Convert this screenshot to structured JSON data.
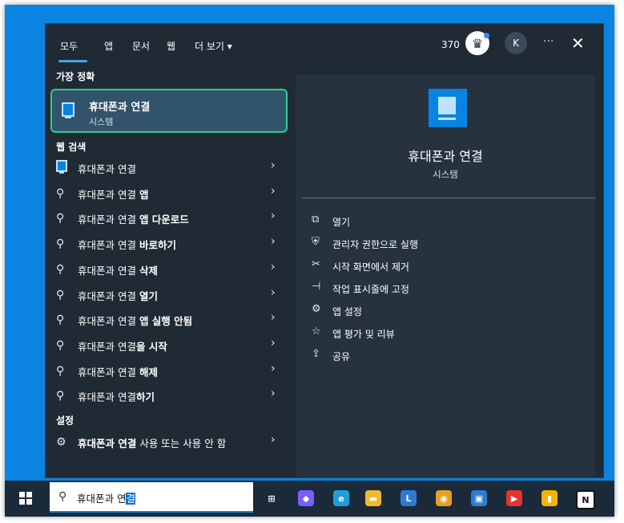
{
  "tabs": [
    "모두",
    "앱",
    "문서",
    "웹",
    "더 보기 ▾"
  ],
  "header": {
    "count": "370",
    "avatar": "K",
    "more": "···",
    "close": "✕"
  },
  "best_match": {
    "section": "가장 정확",
    "title": "휴대폰과 연결",
    "subtitle": "시스템"
  },
  "web_section": "웹 검색",
  "results": [
    {
      "icon": "app",
      "pre": "휴대폰과 연결",
      "bold": ""
    },
    {
      "icon": "search",
      "pre": "휴대폰과 연결 ",
      "bold": "앱"
    },
    {
      "icon": "search",
      "pre": "휴대폰과 연결 ",
      "bold": "앱 다운로드"
    },
    {
      "icon": "search",
      "pre": "휴대폰과 연결 ",
      "bold": "바로하기"
    },
    {
      "icon": "search",
      "pre": "휴대폰과 연결 ",
      "bold": "삭제"
    },
    {
      "icon": "search",
      "pre": "휴대폰과 연결 ",
      "bold": "열기"
    },
    {
      "icon": "search",
      "pre": "휴대폰과 연결 ",
      "bold": "앱 실행 안됨"
    },
    {
      "icon": "search",
      "pre": "휴대폰과 연결",
      "bold": "을 시작"
    },
    {
      "icon": "search",
      "pre": "휴대폰과 연결 ",
      "bold": "해제"
    },
    {
      "icon": "search",
      "pre": "휴대폰과 연결",
      "bold": "하기"
    }
  ],
  "settings_section": "설정",
  "settings_item": {
    "bold": "휴대폰과 연결",
    "rest": " 사용 또는 사용 안 함"
  },
  "detail": {
    "title": "휴대폰과 연결",
    "subtitle": "시스템",
    "actions": [
      {
        "icon": "open-icon",
        "glyph": "⧉",
        "label": "열기"
      },
      {
        "icon": "admin-icon",
        "glyph": "⛨",
        "label": "관리자 권한으로 실행"
      },
      {
        "icon": "unpin-icon",
        "glyph": "✂",
        "label": "시작 화면에서 제거"
      },
      {
        "icon": "pin-taskbar-icon",
        "glyph": "⊣",
        "label": "작업 표시줄에 고정"
      },
      {
        "icon": "gear-icon",
        "glyph": "⚙",
        "label": "앱 설정"
      },
      {
        "icon": "rate-icon",
        "glyph": "☆",
        "label": "앱 평가 및 리뷰"
      },
      {
        "icon": "share-icon",
        "glyph": "⇪",
        "label": "공유"
      }
    ]
  },
  "taskbar": {
    "search_value_plain": "휴대폰과 연",
    "search_value_selected": "결",
    "apps": [
      {
        "name": "task-view-icon",
        "color": "#1b2a39",
        "glyph": "⊞"
      },
      {
        "name": "copilot-icon",
        "color": "#7a5cff",
        "glyph": "◆"
      },
      {
        "name": "edge-icon",
        "color": "#1fa0d8",
        "glyph": "e"
      },
      {
        "name": "file-explorer-icon",
        "color": "#f2b92f",
        "glyph": "▬"
      },
      {
        "name": "app-l-icon",
        "color": "#2e7bd6",
        "glyph": "L"
      },
      {
        "name": "chrome-icon",
        "color": "#e6a020",
        "glyph": "◉"
      },
      {
        "name": "store-icon",
        "color": "#2e7bd6",
        "glyph": "▣"
      },
      {
        "name": "youtube-music-icon",
        "color": "#e53232",
        "glyph": "▶"
      },
      {
        "name": "keep-icon",
        "color": "#f4b400",
        "glyph": "▮"
      },
      {
        "name": "notion-icon",
        "color": "#ffffff",
        "glyph": "N"
      }
    ]
  }
}
